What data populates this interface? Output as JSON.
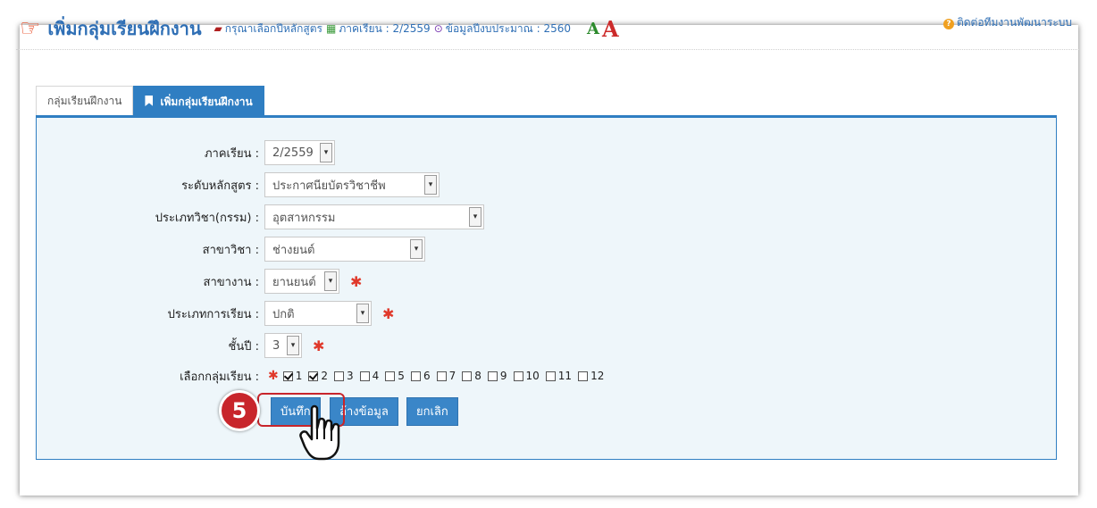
{
  "header": {
    "title": "เพิ่มกลุ่มเรียนฝึกงาน",
    "curriculum_hint": "กรุณาเลือกปีหลักสูตร",
    "semester_label": "ภาคเรียน : 2/2559",
    "budget_label": "ข้อมูลปีงบประมาณ : 2560",
    "font_small": "A",
    "font_large": "A",
    "contact_link": "ติดต่อทีมงานพัฒนาระบบ"
  },
  "tabs": [
    {
      "label": "กลุ่มเรียนฝึกงาน",
      "active": false
    },
    {
      "label": "เพิ่มกลุ่มเรียนฝึกงาน",
      "active": true
    }
  ],
  "form": {
    "semester": {
      "label": "ภาคเรียน :",
      "value": "2/2559"
    },
    "level": {
      "label": "ระดับหลักสูตร :",
      "value": "ประกาศนียบัตรวิชาชีพ"
    },
    "subject_type": {
      "label": "ประเภทวิชา(กรรม) :",
      "value": "อุตสาหกรรม"
    },
    "department": {
      "label": "สาขาวิชา :",
      "value": "ช่างยนต์"
    },
    "major": {
      "label": "สาขางาน :",
      "value": "ยานยนต์"
    },
    "study_type": {
      "label": "ประเภทการเรียน :",
      "value": "ปกติ"
    },
    "year": {
      "label": "ชั้นปี :",
      "value": "3"
    },
    "groups": {
      "label": "เลือกกลุ่มเรียน :",
      "items": [
        {
          "label": "1",
          "checked": true
        },
        {
          "label": "2",
          "checked": true
        },
        {
          "label": "3",
          "checked": false
        },
        {
          "label": "4",
          "checked": false
        },
        {
          "label": "5",
          "checked": false
        },
        {
          "label": "6",
          "checked": false
        },
        {
          "label": "7",
          "checked": false
        },
        {
          "label": "8",
          "checked": false
        },
        {
          "label": "9",
          "checked": false
        },
        {
          "label": "10",
          "checked": false
        },
        {
          "label": "11",
          "checked": false
        },
        {
          "label": "12",
          "checked": false
        }
      ]
    },
    "required_mark": "✱"
  },
  "buttons": {
    "save": "บันทึก",
    "clear": "ล้างข้อมูล",
    "cancel": "ยกเลิก"
  },
  "annotation": {
    "step": "5"
  },
  "icons": {
    "title": "hand-pointing-icon",
    "book": "book-icon",
    "calendar": "calendar-icon",
    "clock": "clock-icon",
    "help": "question-circle-icon",
    "tab_active": "bookmark-icon",
    "cursor": "hand-cursor-icon"
  },
  "colors": {
    "primary": "#2f7ec2",
    "panel_bg": "#eef6fa",
    "required": "#e0392b",
    "step_badge": "#c8252b"
  }
}
